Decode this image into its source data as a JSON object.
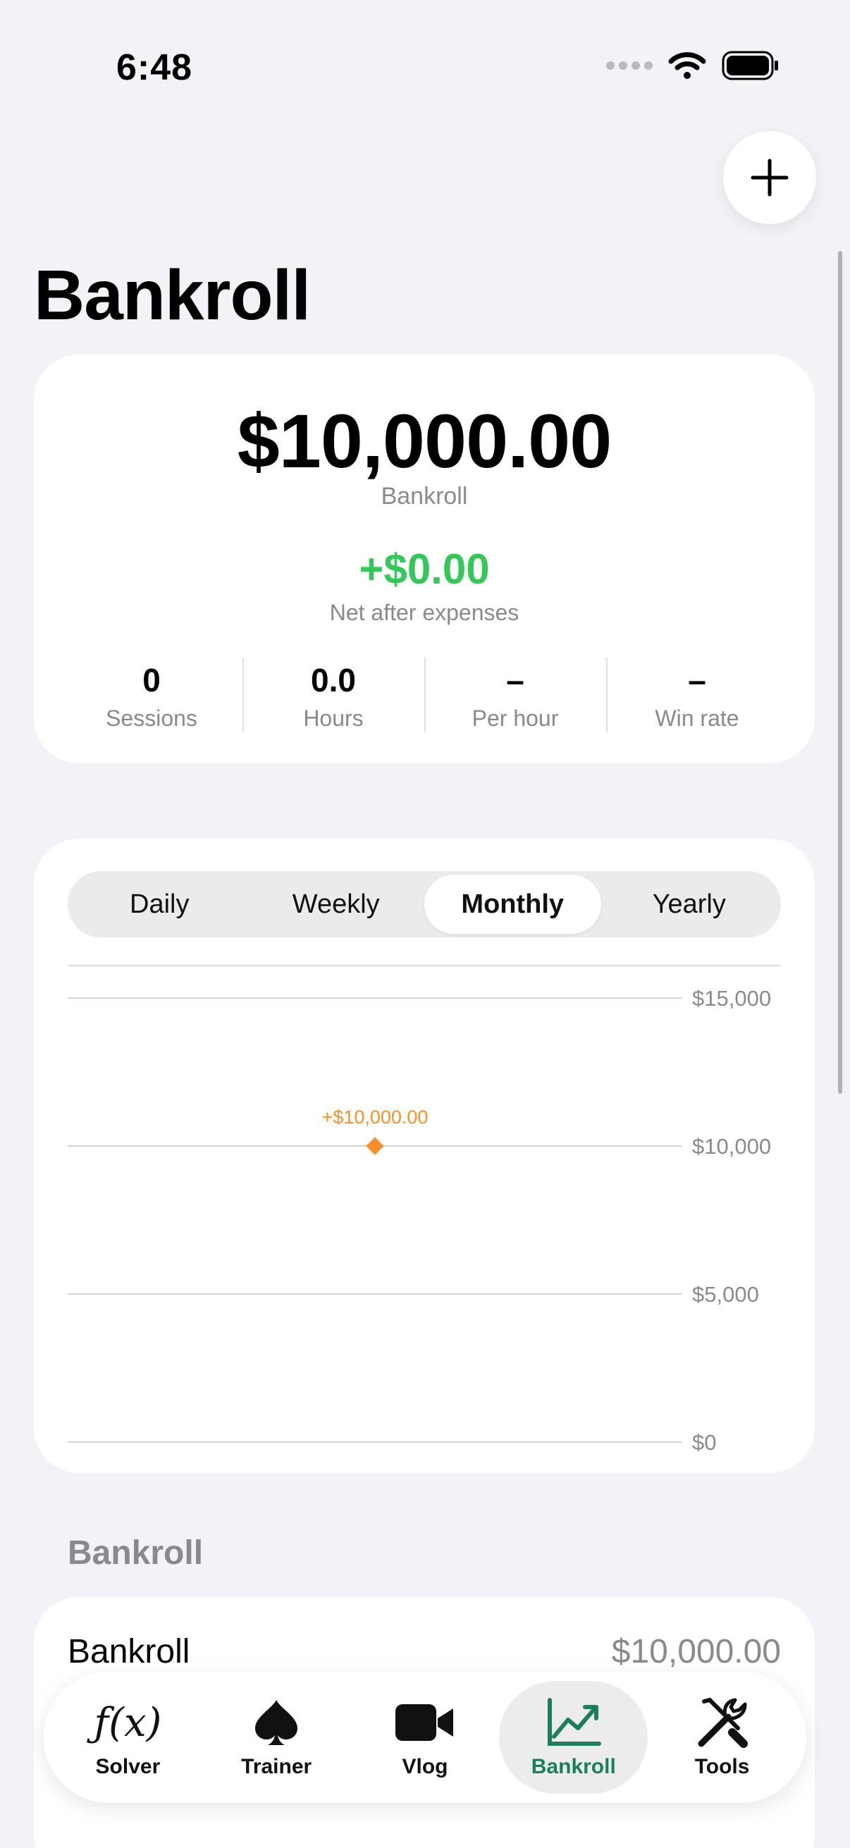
{
  "status_bar": {
    "time": "6:48"
  },
  "title": "Bankroll",
  "summary": {
    "amount": "$10,000.00",
    "amount_label": "Bankroll",
    "net": "+$0.00",
    "net_label": "Net after expenses",
    "net_color": "#34c759",
    "stats": [
      {
        "value": "0",
        "label": "Sessions"
      },
      {
        "value": "0.0",
        "label": "Hours"
      },
      {
        "value": "–",
        "label": "Per hour"
      },
      {
        "value": "–",
        "label": "Win rate"
      }
    ]
  },
  "period_tabs": [
    {
      "label": "Daily",
      "active": false
    },
    {
      "label": "Weekly",
      "active": false
    },
    {
      "label": "Monthly",
      "active": true
    },
    {
      "label": "Yearly",
      "active": false
    }
  ],
  "chart_data": {
    "type": "line",
    "ylim": [
      0,
      15000
    ],
    "yticks": [
      15000,
      10000,
      5000,
      0
    ],
    "ytick_labels": [
      "$15,000",
      "$10,000",
      "$5,000",
      "$0"
    ],
    "points": [
      {
        "y": 10000,
        "label": "+$10,000.00"
      }
    ],
    "color": "#f7902a",
    "grid": true
  },
  "section": {
    "header": "Bankroll",
    "row_label": "Bankroll",
    "row_value": "$10,000.00"
  },
  "tabbar": [
    {
      "label": "Solver",
      "icon": "function-icon",
      "active": false
    },
    {
      "label": "Trainer",
      "icon": "spade-icon",
      "active": false
    },
    {
      "label": "Vlog",
      "icon": "video-camera-icon",
      "active": false
    },
    {
      "label": "Bankroll",
      "icon": "chart-up-icon",
      "active": true
    },
    {
      "label": "Tools",
      "icon": "tools-icon",
      "active": false
    }
  ],
  "accent_color": "#1a7f5a"
}
